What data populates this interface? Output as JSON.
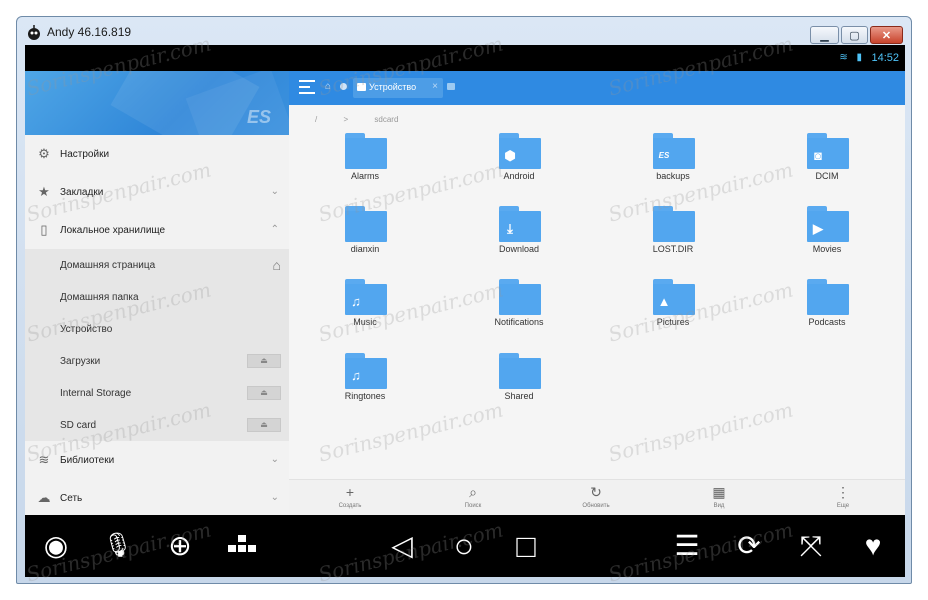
{
  "window": {
    "title": "Andy 46.16.819",
    "minimize_label": "▁",
    "maximize_label": "▢",
    "close_label": "✕"
  },
  "statusbar": {
    "time": "14:52",
    "icons": "≋ ▮"
  },
  "drawer": {
    "logo": "ES",
    "items": [
      {
        "label": "Настройки",
        "icon": "gear-icon",
        "glyph": "⚙"
      },
      {
        "label": "Закладки",
        "icon": "star-icon",
        "glyph": "★",
        "chevron": "⌄"
      },
      {
        "label": "Локальное хранилище",
        "icon": "phone-icon",
        "glyph": "▯",
        "chevron": "⌃"
      }
    ],
    "sub_items": [
      {
        "label": "Домашняя страница",
        "home": "⌂"
      },
      {
        "label": "Домашняя папка"
      },
      {
        "label": "Устройство"
      },
      {
        "label": "Загрузки",
        "eject": "⏏"
      },
      {
        "label": "Internal Storage",
        "eject": "⏏"
      },
      {
        "label": "SD card",
        "eject": "⏏"
      }
    ],
    "bottom_items": [
      {
        "label": "Библиотеки",
        "icon": "library-icon",
        "glyph": "≋",
        "chevron": "⌄"
      },
      {
        "label": "Сеть",
        "icon": "network-icon",
        "glyph": "☁",
        "chevron": "⌄"
      }
    ]
  },
  "toolbar": {
    "tab_label": "Устройство",
    "tab_close": "×",
    "home_glyph": "⌂"
  },
  "breadcrumb": {
    "root": "/",
    "separator": ">",
    "current": "sdcard"
  },
  "folders": [
    {
      "name": "Alarms",
      "symbol": ""
    },
    {
      "name": "Android",
      "symbol": "⬢"
    },
    {
      "name": "backups",
      "symbol": "ES"
    },
    {
      "name": "DCIM",
      "symbol": "◙"
    },
    {
      "name": "dianxin",
      "symbol": ""
    },
    {
      "name": "Download",
      "symbol": "⤓"
    },
    {
      "name": "LOST.DIR",
      "symbol": ""
    },
    {
      "name": "Movies",
      "symbol": "▶"
    },
    {
      "name": "Music",
      "symbol": "♫"
    },
    {
      "name": "Notifications",
      "symbol": ""
    },
    {
      "name": "Pictures",
      "symbol": "▲"
    },
    {
      "name": "Podcasts",
      "symbol": ""
    },
    {
      "name": "Ringtones",
      "symbol": "♫"
    },
    {
      "name": "Shared",
      "symbol": ""
    }
  ],
  "bottombar": [
    {
      "label": "Создать",
      "glyph": "+"
    },
    {
      "label": "Поиск",
      "glyph": "⌕"
    },
    {
      "label": "Обновить",
      "glyph": "↻"
    },
    {
      "label": "Вид",
      "glyph": "▦"
    },
    {
      "label": "Еще",
      "glyph": "⋮"
    }
  ],
  "navbar": {
    "camera": "◉",
    "mic": "🎙",
    "gps": "⊕",
    "keyboard": "▪",
    "back": "◁",
    "home": "○",
    "recents": "□",
    "menu": "☰",
    "rotate": "⟳",
    "fullscreen": "⤧",
    "favorite": "♥"
  },
  "watermark": "Sorinspenpair.com"
}
